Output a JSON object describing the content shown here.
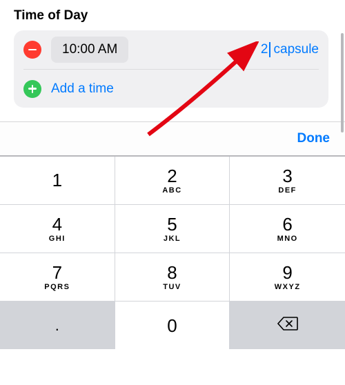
{
  "section": {
    "title": "Time of Day"
  },
  "entry": {
    "time": "10:00 AM",
    "qty": "2",
    "unit": "capsule"
  },
  "add_label": "Add a time",
  "accessory": {
    "done": "Done"
  },
  "keypad": {
    "k1": {
      "num": "1",
      "let": ""
    },
    "k2": {
      "num": "2",
      "let": "ABC"
    },
    "k3": {
      "num": "3",
      "let": "DEF"
    },
    "k4": {
      "num": "4",
      "let": "GHI"
    },
    "k5": {
      "num": "5",
      "let": "JKL"
    },
    "k6": {
      "num": "6",
      "let": "MNO"
    },
    "k7": {
      "num": "7",
      "let": "PQRS"
    },
    "k8": {
      "num": "8",
      "let": "TUV"
    },
    "k9": {
      "num": "9",
      "let": "WXYZ"
    },
    "dot": {
      "num": "."
    },
    "k0": {
      "num": "0"
    }
  }
}
